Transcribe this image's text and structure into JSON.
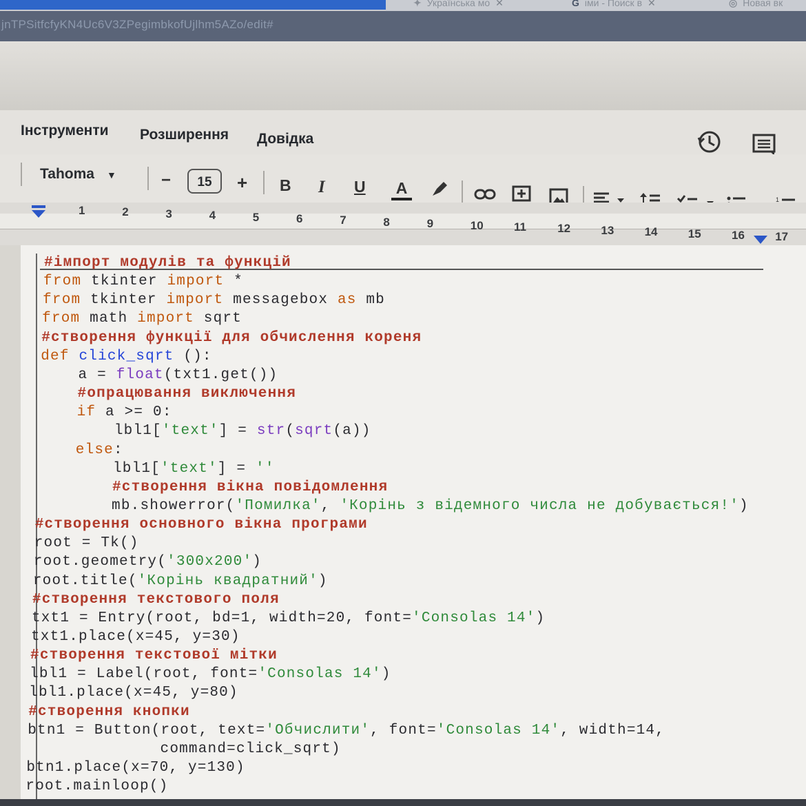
{
  "browser": {
    "tabs": [
      {
        "icon": "yellow-star-icon",
        "label": "Українська мо",
        "close": "✕"
      },
      {
        "icon": "google-icon",
        "label": "іми - Поиск в",
        "close": "✕"
      },
      {
        "icon": "openai-icon",
        "label": "Новая вк",
        "close": ""
      }
    ],
    "address": "jnTPSitfcfyKN4Uc6V3ZPegimbkofUjlhm5AZo/edit#"
  },
  "menu": {
    "items": [
      "Інструменти",
      "Розширення",
      "Довідка"
    ]
  },
  "toolbar": {
    "font_family": "Tahoma",
    "font_size": "15",
    "minus": "−",
    "plus": "+",
    "bold": "B",
    "italic": "I",
    "underline": "U",
    "text_color": "A"
  },
  "ruler": {
    "numbers": [
      "1",
      "2",
      "3",
      "4",
      "5",
      "6",
      "7",
      "8",
      "9",
      "10",
      "11",
      "12",
      "13",
      "14",
      "15",
      "16",
      "17"
    ]
  },
  "code": {
    "lines": [
      {
        "t": "#імпорт модулів та функцій"
      },
      {
        "t": "from tkinter import *"
      },
      {
        "t": "from tkinter import messagebox as mb"
      },
      {
        "t": "from math import sqrt"
      },
      {
        "t": "#створення функції для обчислення кореня"
      },
      {
        "t": "def click_sqrt ():"
      },
      {
        "t": "    a = float(txt1.get())"
      },
      {
        "t": "    #опрацювання виключення"
      },
      {
        "t": "    if a >= 0:"
      },
      {
        "t": "        lbl1['text'] = str(sqrt(a))"
      },
      {
        "t": "    else:"
      },
      {
        "t": "        lbl1['text'] = ''"
      },
      {
        "t": "        #створення вікна повідомлення"
      },
      {
        "t": "        mb.showerror('Помилка', 'Корінь з відемного числа не добувається!')"
      },
      {
        "t": "#створення основного вікна програми"
      },
      {
        "t": "root = Tk()"
      },
      {
        "t": "root.geometry('300x200')"
      },
      {
        "t": "root.title('Корінь квадратний')"
      },
      {
        "t": "#створення текстового поля"
      },
      {
        "t": "txt1 = Entry(root, bd=1, width=20, font='Consolas 14')"
      },
      {
        "t": "txt1.place(x=45, y=30)"
      },
      {
        "t": "#створення текстової мітки"
      },
      {
        "t": "lbl1 = Label(root, font='Consolas 14')"
      },
      {
        "t": "lbl1.place(x=45, y=80)"
      },
      {
        "t": "#створення кнопки"
      },
      {
        "t": "btn1 = Button(root, text='Обчислити', font='Consolas 14', width=14,"
      },
      {
        "t": "              command=click_sqrt)"
      },
      {
        "t": "btn1.place(x=70, y=130)"
      },
      {
        "t": "root.mainloop()"
      }
    ]
  }
}
